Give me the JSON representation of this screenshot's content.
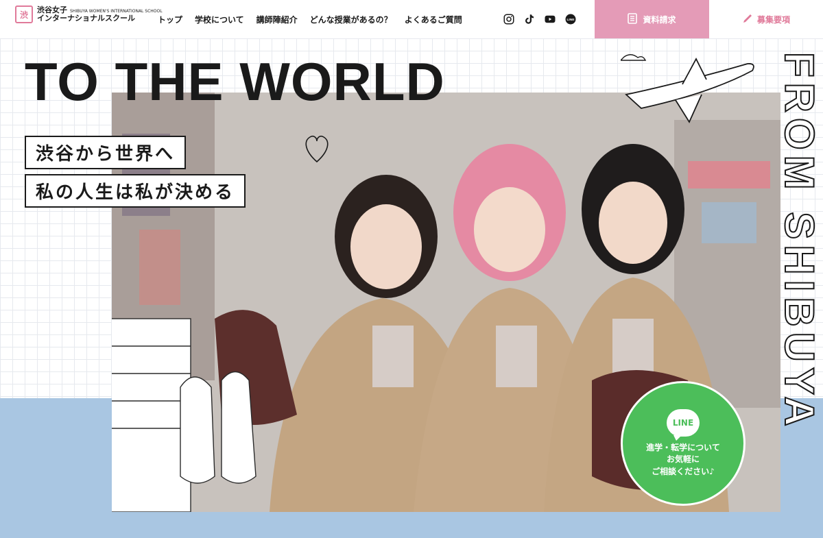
{
  "header": {
    "logo_mark": "渋",
    "logo_name_ja": "渋谷女子",
    "logo_name_en": "SHIBUYA WOMEN'S INTERNATIONAL SCHOOL",
    "logo_sub": "インターナショナルスクール",
    "nav": [
      {
        "label": "トップ"
      },
      {
        "label": "学校について"
      },
      {
        "label": "講師陣紹介"
      },
      {
        "label": "どんな授業があるの？"
      },
      {
        "label": "よくあるご質問"
      }
    ],
    "social": [
      "instagram-icon",
      "tiktok-icon",
      "youtube-icon",
      "line-icon"
    ],
    "line_small": "LINE",
    "request_label": "資料請求",
    "recruit_label": "募集要項"
  },
  "hero": {
    "title": "TO THE WORLD",
    "catch1": "渋谷から世界へ",
    "catch2": "私の人生は私が決める",
    "vertical": "FROM SHIBUYA",
    "line": {
      "logo": "LINE",
      "text1": "進学・転学について",
      "text2": "お気軽に",
      "text3": "ご相談ください♪"
    }
  },
  "colors": {
    "pink": "#e49bb7",
    "pink_text": "#e07a9a",
    "line_green": "#4cbe5a",
    "band_blue": "#a9c6e2"
  }
}
